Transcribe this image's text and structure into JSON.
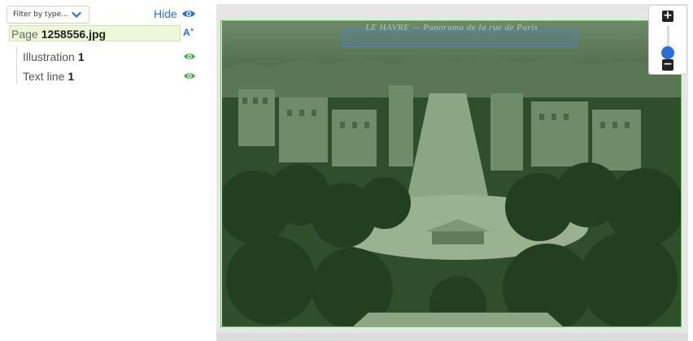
{
  "sidebar": {
    "filter": {
      "placeholder": "Filter by type..."
    },
    "visibility_toggle": {
      "label": "Hide",
      "icon": "eye-icon"
    },
    "page": {
      "prefix": "Page",
      "name": "1258556.jpg"
    },
    "font_size_button": {
      "label": "A",
      "superscript": "+"
    },
    "items": [
      {
        "label": "Illustration",
        "count": "1",
        "icon": "eye-icon"
      },
      {
        "label": "Text line",
        "count": "1",
        "icon": "eye-icon"
      }
    ]
  },
  "viewer": {
    "caption": "LE HAVRE — Panorama de la rue de Paris",
    "zoom": {
      "in_icon": "plus-icon",
      "out_icon": "minus-icon",
      "level": 0.2
    }
  },
  "colors": {
    "accent": "#2a6fd6",
    "eye": "#3cb43c",
    "page_outline": "#56d24a",
    "textline_outline": "#4a7fe0",
    "page_highlight": "#eef7d8"
  }
}
